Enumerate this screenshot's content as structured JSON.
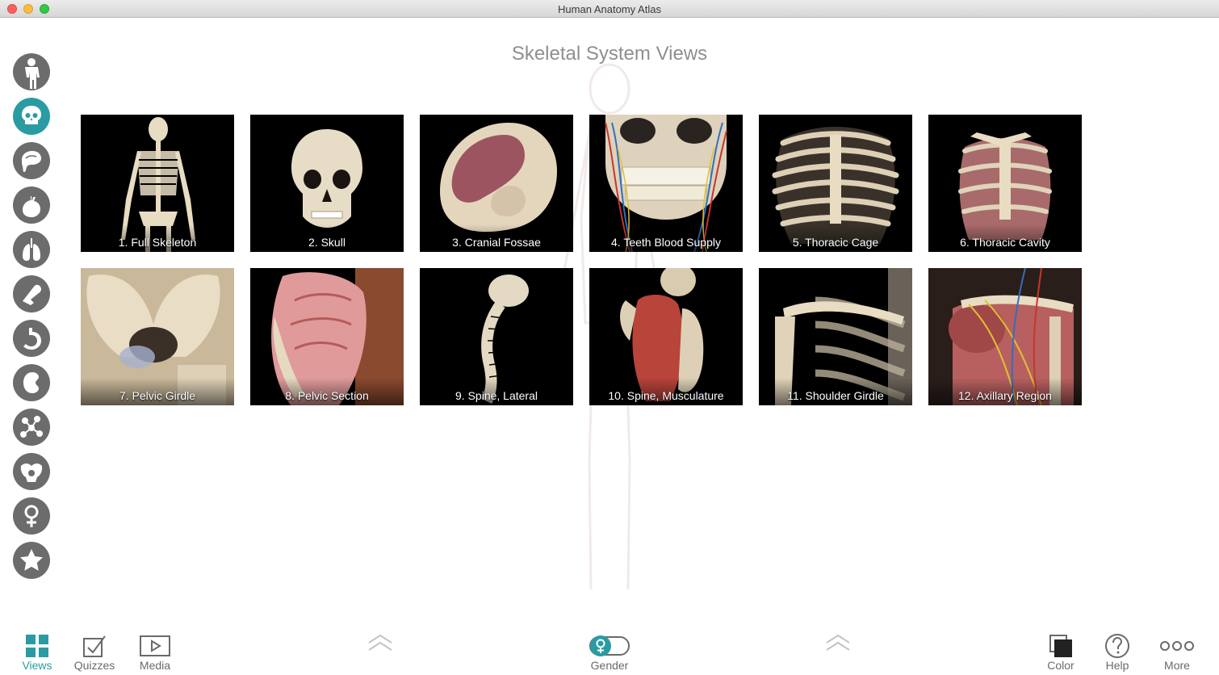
{
  "window": {
    "title": "Human Anatomy Atlas"
  },
  "page": {
    "title": "Skeletal System Views"
  },
  "sidebar": {
    "items": [
      {
        "name": "full-body"
      },
      {
        "name": "skeletal",
        "active": true
      },
      {
        "name": "nervous"
      },
      {
        "name": "cardiovascular"
      },
      {
        "name": "respiratory"
      },
      {
        "name": "muscular"
      },
      {
        "name": "digestive"
      },
      {
        "name": "urinary"
      },
      {
        "name": "lymphatic"
      },
      {
        "name": "reproductive"
      },
      {
        "name": "female"
      },
      {
        "name": "favorites"
      }
    ]
  },
  "views": [
    {
      "label": "1. Full Skeleton"
    },
    {
      "label": "2. Skull"
    },
    {
      "label": "3. Cranial Fossae"
    },
    {
      "label": "4. Teeth Blood Supply"
    },
    {
      "label": "5. Thoracic Cage"
    },
    {
      "label": "6. Thoracic Cavity"
    },
    {
      "label": "7. Pelvic Girdle"
    },
    {
      "label": "8. Pelvic Section"
    },
    {
      "label": "9. Spine, Lateral"
    },
    {
      "label": "10. Spine, Musculature"
    },
    {
      "label": "11. Shoulder Girdle"
    },
    {
      "label": "12. Axillary Region"
    }
  ],
  "toolbar": {
    "views": "Views",
    "quizzes": "Quizzes",
    "media": "Media",
    "gender": "Gender",
    "color": "Color",
    "help": "Help",
    "more": "More"
  },
  "colors": {
    "accent": "#2a9ba3",
    "icon": "#6c6c6c"
  }
}
